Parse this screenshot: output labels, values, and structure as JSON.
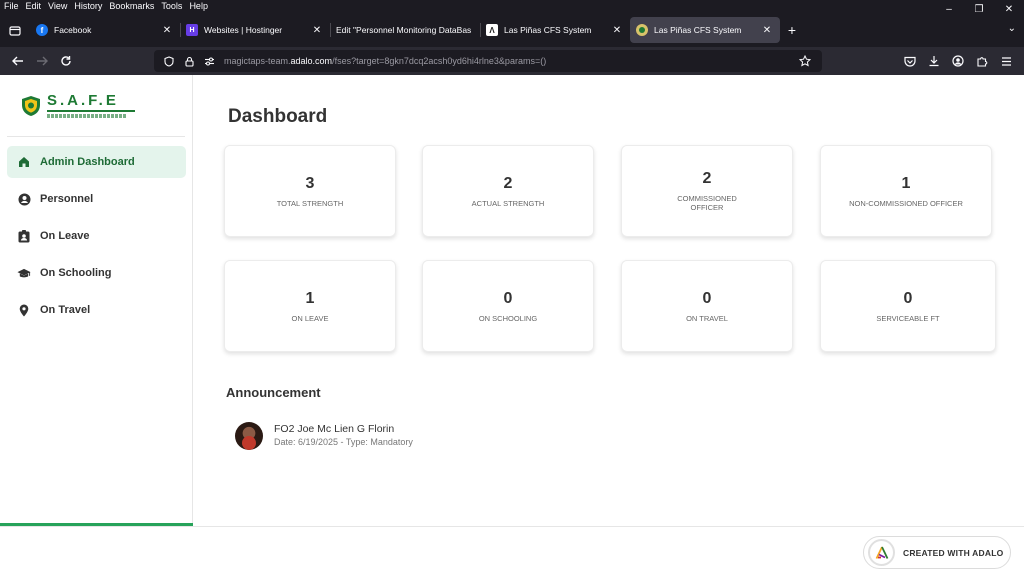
{
  "menubar": {
    "items": [
      "File",
      "Edit",
      "View",
      "History",
      "Bookmarks",
      "Tools",
      "Help"
    ]
  },
  "tabs": [
    {
      "title": "Facebook",
      "favicon": "facebook-icon",
      "color": "#1877f2"
    },
    {
      "title": "Websites | Hostinger",
      "favicon": "hostinger-icon",
      "color": "#673de6"
    },
    {
      "title": "Edit \"Personnel Monitoring DataBas",
      "favicon": "none",
      "color": ""
    },
    {
      "title": "Las Piñas CFS System",
      "favicon": "adalo-icon",
      "color": "#ffffff"
    },
    {
      "title": "Las Piñas CFS System",
      "favicon": "safe-logo-icon",
      "color": "#1e7a34",
      "active": true
    }
  ],
  "url": {
    "prefix": "magictaps-team.",
    "domain": "adalo.com",
    "path": "/fses?target=8gkn7dcq2acsh0yd6hi4rlne3&params=()"
  },
  "logo": {
    "title": "S.A.F.E"
  },
  "sidebar": {
    "items": [
      {
        "label": "Admin Dashboard",
        "icon": "home-icon",
        "active": true
      },
      {
        "label": "Personnel",
        "icon": "person-icon"
      },
      {
        "label": "On Leave",
        "icon": "badge-icon"
      },
      {
        "label": "On Schooling",
        "icon": "graduation-cap-icon"
      },
      {
        "label": "On Travel",
        "icon": "location-pin-icon"
      }
    ]
  },
  "page": {
    "title": "Dashboard"
  },
  "cards": [
    {
      "value": "3",
      "label": "TOTAL STRENGTH"
    },
    {
      "value": "2",
      "label": "ACTUAL STRENGTH"
    },
    {
      "value": "2",
      "label": "COMMISSIONED\nOFFICER"
    },
    {
      "value": "1",
      "label": "NON-COMMISSIONED OFFICER"
    },
    {
      "value": "1",
      "label": "ON LEAVE"
    },
    {
      "value": "0",
      "label": "ON SCHOOLING"
    },
    {
      "value": "0",
      "label": "ON TRAVEL"
    },
    {
      "value": "0",
      "label": "SERVICEABLE FT"
    }
  ],
  "announcement": {
    "title": "Announcement",
    "items": [
      {
        "name": "FO2 Joe Mc Lien G Florin",
        "meta": "Date: 6/19/2025 - Type:  Mandatory"
      }
    ]
  },
  "badge": {
    "label": "CREATED WITH ADALO"
  },
  "colors": {
    "accent": "#1e7a34",
    "active_bg": "#e4f4ec",
    "progress": "#27a35a"
  }
}
